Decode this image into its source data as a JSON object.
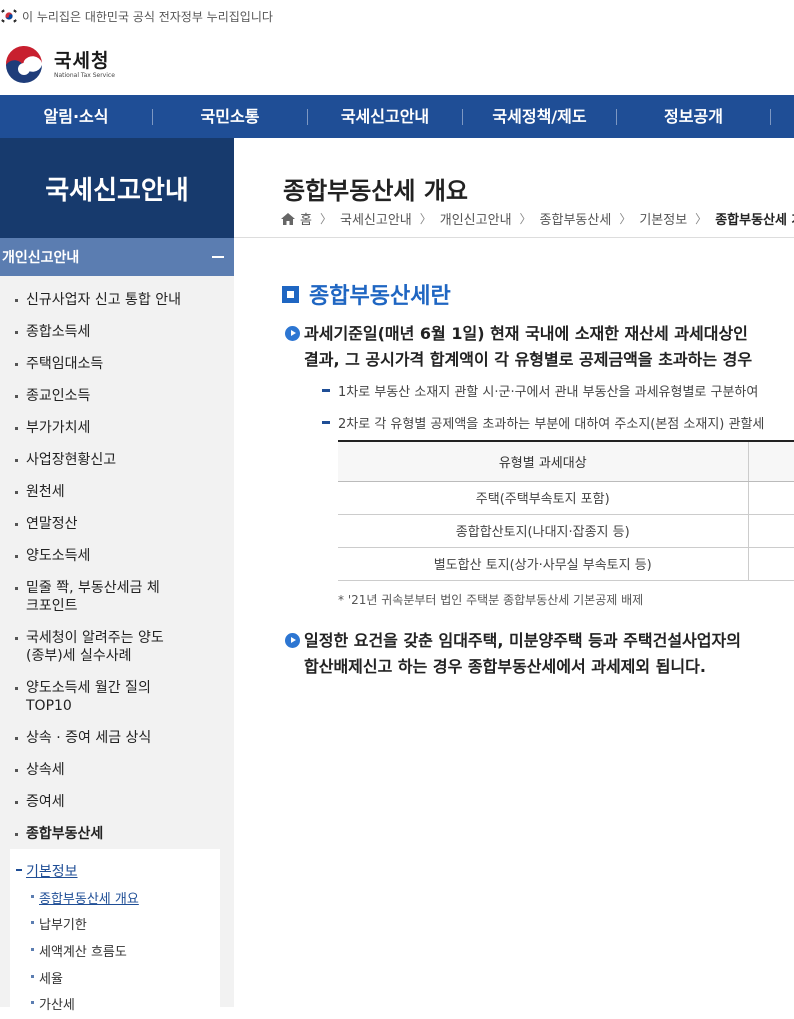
{
  "gov_banner": {
    "text": "이 누리집은 대한민국 공식 전자정부 누리집입니다"
  },
  "logo": {
    "ko": "국세청",
    "en": "National Tax Service"
  },
  "gnb": [
    "알림·소식",
    "국민소통",
    "국세신고안내",
    "국세정책/제도",
    "정보공개"
  ],
  "sidebar": {
    "title": "국세신고안내",
    "section": "개인신고안내",
    "items": [
      "신규사업자 신고 통합 안내",
      "종합소득세",
      "주택임대소득",
      "종교인소득",
      "부가가치세",
      "사업장현황신고",
      "원천세",
      "연말정산",
      "양도소득세",
      "밑줄 쫙, 부동산세금 체크포인트",
      "국세청이 알려주는 양도(종부)세 실수사례",
      "양도소득세 월간 질의 TOP10",
      "상속 · 증여 세금 상식",
      "상속세",
      "증여세",
      "종합부동산세"
    ],
    "sub_head": "기본정보",
    "sub_items": [
      "종합부동산세 개요",
      "납부기한",
      "세액계산 흐름도",
      "세율",
      "가산세"
    ]
  },
  "main": {
    "title": "종합부동산세 개요",
    "breadcrumb": [
      "홈",
      "국세신고안내",
      "개인신고안내",
      "종합부동산세",
      "기본정보",
      "종합부동산세 개요"
    ],
    "heading": "종합부동산세란",
    "para1_line1": "과세기준일(매년 6월 1일) 현재 국내에 소재한 재산세 과세대상인",
    "para1_line2": "결과, 그 공시가격 합계액이 각 유형별로 공제금액을 초과하는 경우",
    "dash1": "1차로 부동산 소재지 관할 시·군·구에서 관내 부동산을 과세유형별로 구분하여",
    "dash2": "2차로 각 유형별 공제액을 초과하는 부분에 대하여 주소지(본점 소재지) 관할세",
    "table": {
      "header": "유형별 과세대상",
      "rows": [
        "주택(주택부속토지 포함)",
        "종합합산토지(나대지·잡종지 등)",
        "별도합산 토지(상가·사무실 부속토지 등)"
      ]
    },
    "note": "* '21년 귀속분부터 법인 주택분 종합부동산세 기본공제 배제",
    "para2_line1": "일정한 요건을 갖춘 임대주택, 미분양주택 등과 주택건설사업자의",
    "para2_line2": "합산배제신고 하는 경우 종합부동산세에서 과세제외 됩니다."
  }
}
